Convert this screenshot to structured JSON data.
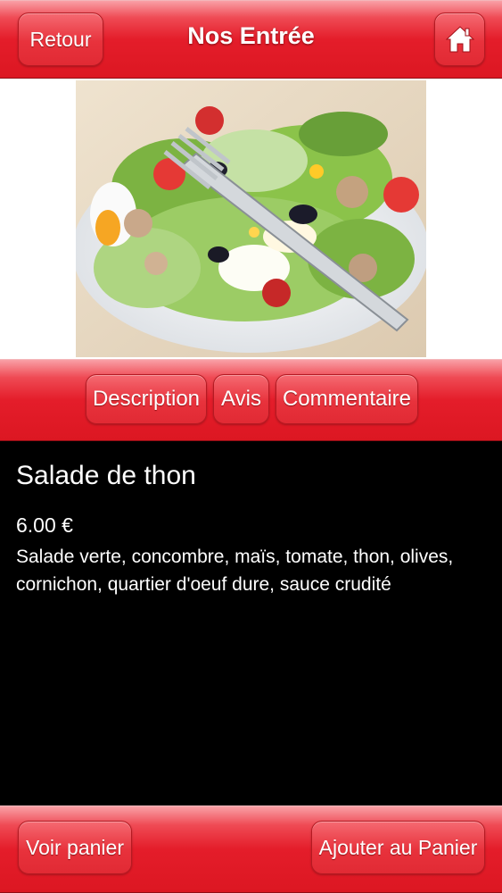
{
  "header": {
    "back_label": "Retour",
    "title": "Nos Entrée",
    "home_icon": "home-icon"
  },
  "product_image": {
    "description": "bowl of salad with a fork",
    "icon": "salad-photo"
  },
  "tabs": [
    {
      "label": "Description"
    },
    {
      "label": "Avis"
    },
    {
      "label": "Commentaire"
    }
  ],
  "dish": {
    "name": "Salade de thon",
    "price": "6.00 €",
    "description": "Salade verte, concombre, maïs, tomate, thon, olives, cornichon, quartier d'oeuf dure, sauce crudité"
  },
  "footer": {
    "cart_label": "Voir panier",
    "add_label": "Ajouter au Panier"
  },
  "colors": {
    "accent": "#e41d2a",
    "content_bg": "#000000",
    "text": "#ffffff"
  }
}
